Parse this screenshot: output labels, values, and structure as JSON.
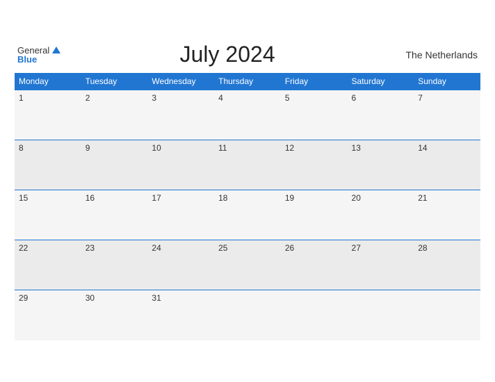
{
  "header": {
    "title": "July 2024",
    "country": "The Netherlands",
    "logo_general": "General",
    "logo_blue": "Blue"
  },
  "weekdays": [
    "Monday",
    "Tuesday",
    "Wednesday",
    "Thursday",
    "Friday",
    "Saturday",
    "Sunday"
  ],
  "weeks": [
    [
      1,
      2,
      3,
      4,
      5,
      6,
      7
    ],
    [
      8,
      9,
      10,
      11,
      12,
      13,
      14
    ],
    [
      15,
      16,
      17,
      18,
      19,
      20,
      21
    ],
    [
      22,
      23,
      24,
      25,
      26,
      27,
      28
    ],
    [
      29,
      30,
      31,
      null,
      null,
      null,
      null
    ]
  ]
}
